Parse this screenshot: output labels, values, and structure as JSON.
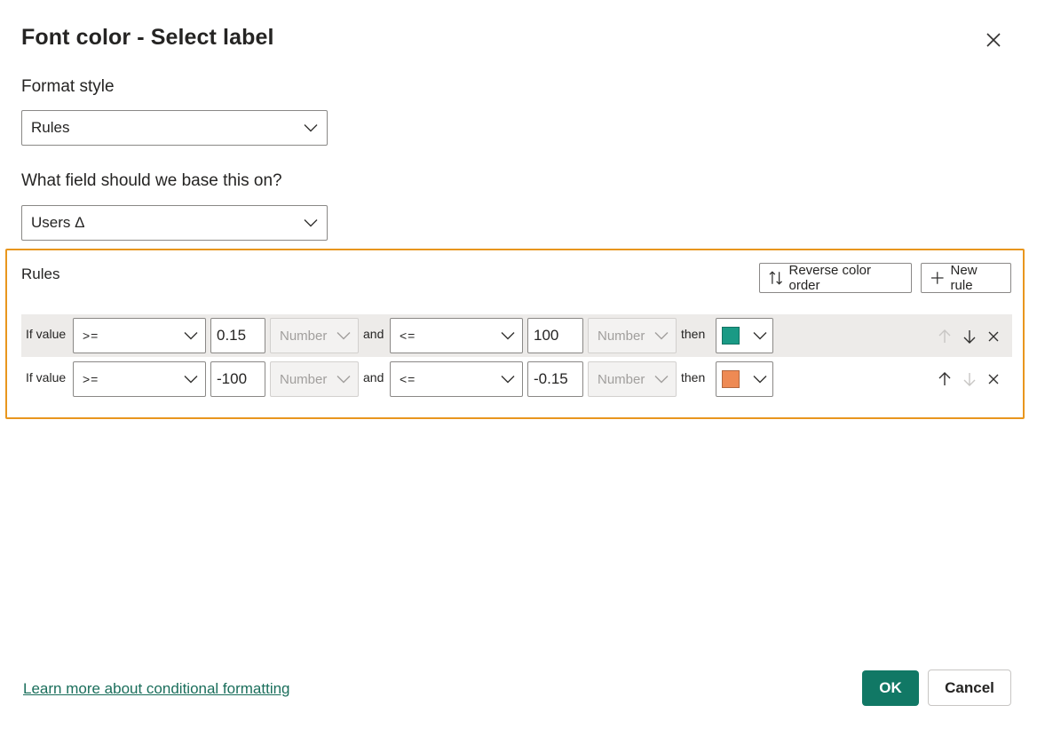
{
  "dialog": {
    "title": "Font color - Select label"
  },
  "format_style": {
    "label": "Format style",
    "value": "Rules"
  },
  "field": {
    "label": "What field should we base this on?",
    "value": "Users Δ"
  },
  "rules": {
    "title": "Rules",
    "reverse_label": "Reverse color order",
    "new_rule_label": "New rule",
    "rows": [
      {
        "if_label": "If value",
        "op1": ">=",
        "value1": "0.15",
        "type1": "Number",
        "and_label": "and",
        "op2": "<=",
        "value2": "100",
        "type2": "Number",
        "then_label": "then",
        "color": "#1a9a85"
      },
      {
        "if_label": "If value",
        "op1": ">=",
        "value1": "-100",
        "type1": "Number",
        "and_label": "and",
        "op2": "<=",
        "value2": "-0.15",
        "type2": "Number",
        "then_label": "then",
        "color": "#ee8a54"
      }
    ]
  },
  "footer": {
    "learn_more": "Learn more about conditional formatting",
    "ok": "OK",
    "cancel": "Cancel"
  },
  "colors": {
    "accent": "#117865",
    "highlight_border": "#e8961e"
  },
  "icons": {
    "close": "close-icon",
    "chevron": "chevron-down-icon",
    "reverse": "sort-arrows-icon",
    "add": "plus-icon",
    "up": "arrow-up-icon",
    "down": "arrow-down-icon",
    "delete": "delete-icon"
  }
}
